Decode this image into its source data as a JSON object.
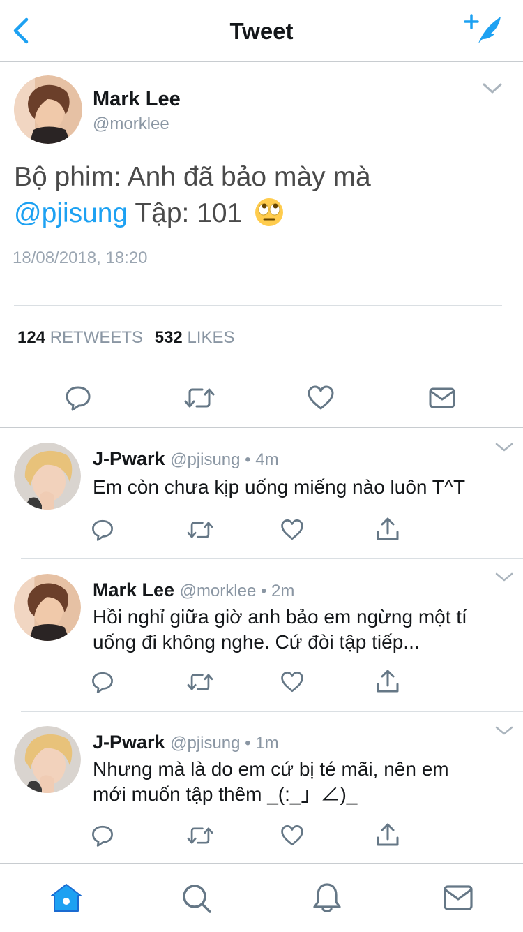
{
  "header": {
    "title": "Tweet",
    "back_icon": "chevron-left-icon",
    "compose_icon": "compose-tweet-icon",
    "accent_color": "#1da1f2"
  },
  "tweet": {
    "name": "Mark Lee",
    "handle": "@morklee",
    "text_part1": "Bộ phim: Anh đã bảo mày mà",
    "mention": "@pjisung",
    "text_part2": " Tập: 101",
    "emoji": "face-with-rolling-eyes",
    "timestamp": "18/08/2018, 18:20",
    "retweets_count": "124",
    "retweets_label": "RETWEETS",
    "likes_count": "532",
    "likes_label": "LIKES",
    "actions": [
      "reply-icon",
      "retweet-icon",
      "like-icon",
      "message-icon"
    ]
  },
  "replies": [
    {
      "name": "J-Pwark",
      "handle": "@pjisung",
      "meta": " • 4m",
      "lines": [
        "Em còn chưa kịp uống miếng nào luôn T^T"
      ]
    },
    {
      "name": "Mark Lee",
      "handle": "@morklee",
      "meta": " • 2m",
      "lines": [
        "Hồi nghỉ giữa giờ anh bảo em ngừng một tí",
        "uống đi không nghe. Cứ đòi tập tiếp..."
      ]
    },
    {
      "name": "J-Pwark",
      "handle": "@pjisung",
      "meta": " • 1m",
      "lines": [
        "Nhưng mà là do em cứ bị té mãi, nên em",
        "mới muốn tập thêm _(:_」∠)_"
      ]
    }
  ],
  "tabbar": {
    "items": [
      "home-icon",
      "search-icon",
      "notifications-icon",
      "messages-icon"
    ],
    "active": "home-icon"
  }
}
